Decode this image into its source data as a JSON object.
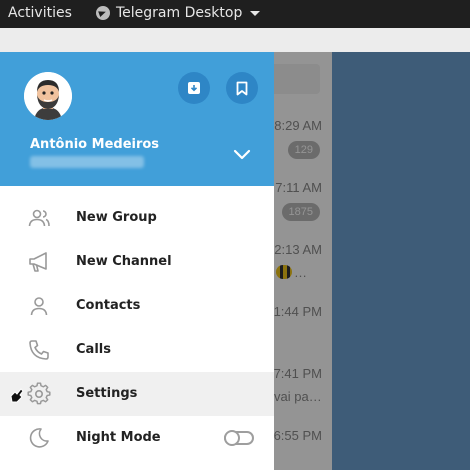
{
  "topbar": {
    "activities": "Activities",
    "app_name": "Telegram Desktop"
  },
  "background_chats": {
    "times": [
      "8:29 AM",
      "7:11 AM",
      "2:13 AM",
      "1:44 PM",
      "7:41 PM",
      "6:55 PM"
    ],
    "badges": [
      "129",
      "1875"
    ],
    "snippets": [
      "…",
      "vai pa…"
    ]
  },
  "drawer": {
    "user_name": "Antônio Medeiros",
    "menu": [
      {
        "label": "New Group",
        "icon": "group-icon"
      },
      {
        "label": "New Channel",
        "icon": "megaphone-icon"
      },
      {
        "label": "Contacts",
        "icon": "contact-icon"
      },
      {
        "label": "Calls",
        "icon": "phone-icon"
      },
      {
        "label": "Settings",
        "icon": "gear-icon"
      },
      {
        "label": "Night Mode",
        "icon": "moon-icon"
      }
    ],
    "night_mode_enabled": false
  },
  "colors": {
    "header_accent": "#419fd9",
    "header_button": "#2e86c6",
    "chat_background": "#6b9fcf",
    "topbar": "#1f1f1f"
  }
}
